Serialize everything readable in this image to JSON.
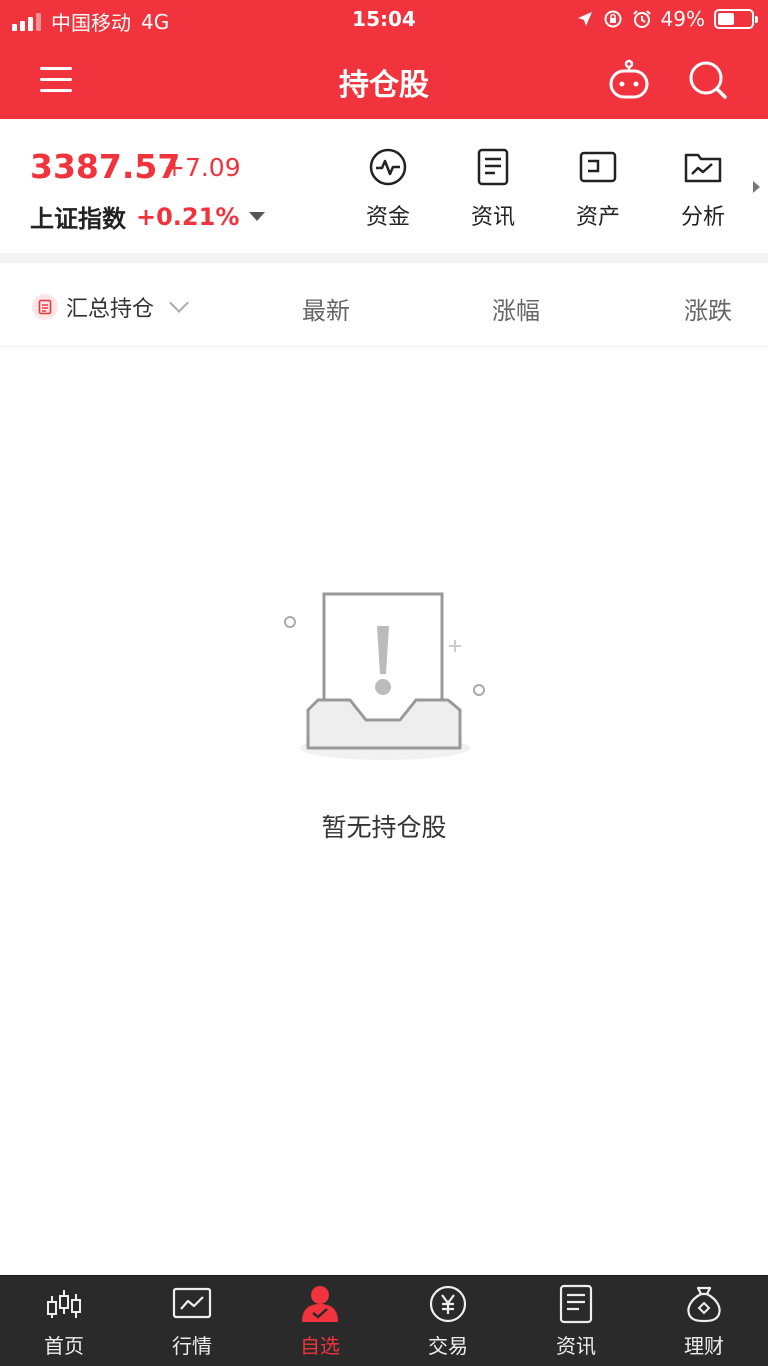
{
  "status_bar": {
    "carrier": "中国移动",
    "network": "4G",
    "time": "15:04",
    "battery": "49%"
  },
  "header": {
    "title": "持仓股",
    "menu_icon": "hamburger-menu-icon",
    "robot_icon": "robot-assistant-icon",
    "search_icon": "search-icon"
  },
  "index": {
    "value": "3387.57",
    "change": "+7.09",
    "name": "上证指数",
    "change_pct": "+0.21%"
  },
  "quick_links": [
    {
      "label": "资金",
      "icon": "pulse-icon"
    },
    {
      "label": "资讯",
      "icon": "document-icon"
    },
    {
      "label": "资产",
      "icon": "card-icon"
    },
    {
      "label": "分析",
      "icon": "folder-chart-icon"
    }
  ],
  "columns": {
    "aggregate": "汇总持仓",
    "latest": "最新",
    "change_pct": "涨幅",
    "change": "涨跌"
  },
  "empty_state": {
    "text": "暂无持仓股"
  },
  "tabbar": [
    {
      "label": "首页",
      "icon": "candlestick-icon"
    },
    {
      "label": "行情",
      "icon": "line-chart-icon"
    },
    {
      "label": "自选",
      "icon": "user-check-icon"
    },
    {
      "label": "交易",
      "icon": "yuan-coin-icon"
    },
    {
      "label": "资讯",
      "icon": "document-icon"
    },
    {
      "label": "理财",
      "icon": "money-bag-icon"
    }
  ],
  "colors": {
    "brand_red": "#f0333c",
    "tabbar_bg": "#2a2a2a"
  }
}
